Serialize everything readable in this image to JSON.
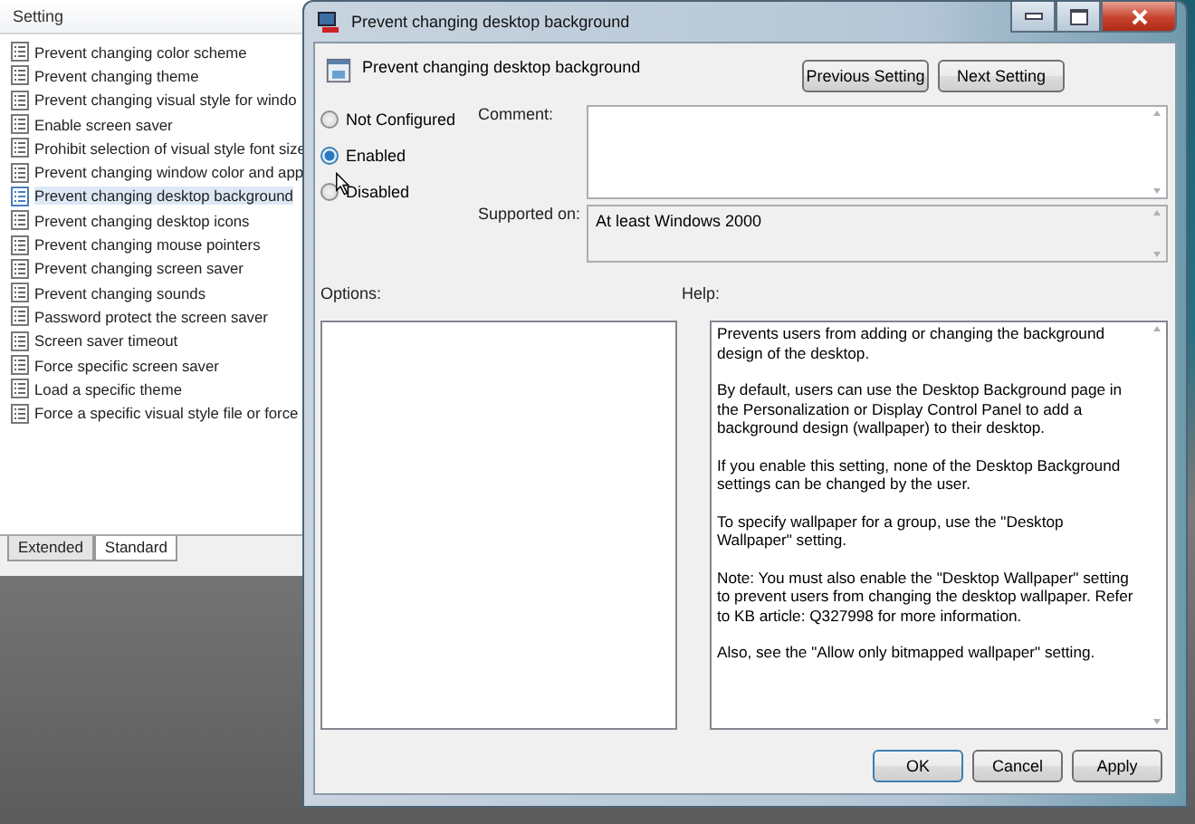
{
  "settings_list": {
    "column_header": "Setting",
    "items": [
      {
        "label": "Prevent changing color scheme",
        "selected": false
      },
      {
        "label": "Prevent changing theme",
        "selected": false
      },
      {
        "label": "Prevent changing visual style for windo",
        "selected": false
      },
      {
        "label": "Enable screen saver",
        "selected": false
      },
      {
        "label": "Prohibit selection of visual style font size",
        "selected": false
      },
      {
        "label": "Prevent changing window color and app",
        "selected": false
      },
      {
        "label": "Prevent changing desktop background",
        "selected": true
      },
      {
        "label": "Prevent changing desktop icons",
        "selected": false
      },
      {
        "label": "Prevent changing mouse pointers",
        "selected": false
      },
      {
        "label": "Prevent changing screen saver",
        "selected": false
      },
      {
        "label": "Prevent changing sounds",
        "selected": false
      },
      {
        "label": "Password protect the screen saver",
        "selected": false
      },
      {
        "label": "Screen saver timeout",
        "selected": false
      },
      {
        "label": "Force specific screen saver",
        "selected": false
      },
      {
        "label": "Load a specific theme",
        "selected": false
      },
      {
        "label": "Force a specific visual style file or force",
        "selected": false
      }
    ],
    "tabs": [
      {
        "label": "Extended",
        "selected": false
      },
      {
        "label": "Standard",
        "selected": true
      }
    ]
  },
  "dialog": {
    "title": "Prevent changing desktop background",
    "heading": "Prevent changing desktop background",
    "nav_buttons": [
      "Previous Setting",
      "Next Setting"
    ],
    "states": [
      {
        "label": "Not Configured",
        "selected": false
      },
      {
        "label": "Enabled",
        "selected": true
      },
      {
        "label": "Disabled",
        "selected": false
      }
    ],
    "comment_label": "Comment:",
    "supported_label": "Supported on:",
    "supported_value": "At least Windows 2000",
    "options_label": "Options:",
    "help_label": "Help:",
    "help_paragraphs": [
      "Prevents users from adding or changing the background design of the desktop.",
      "By default, users can use the Desktop Background page in the Personalization or Display Control Panel to add a background design (wallpaper) to their desktop.",
      "If you enable this setting, none of the Desktop Background settings can be changed by the user.",
      "To specify wallpaper for a group, use the \"Desktop Wallpaper\" setting.",
      "Note: You must also enable the \"Desktop Wallpaper\" setting to prevent users from changing the desktop wallpaper. Refer to KB article: Q327998 for more information.",
      "Also, see the \"Allow only bitmapped wallpaper\" setting."
    ],
    "buttons": [
      "OK",
      "Cancel",
      "Apply"
    ]
  }
}
